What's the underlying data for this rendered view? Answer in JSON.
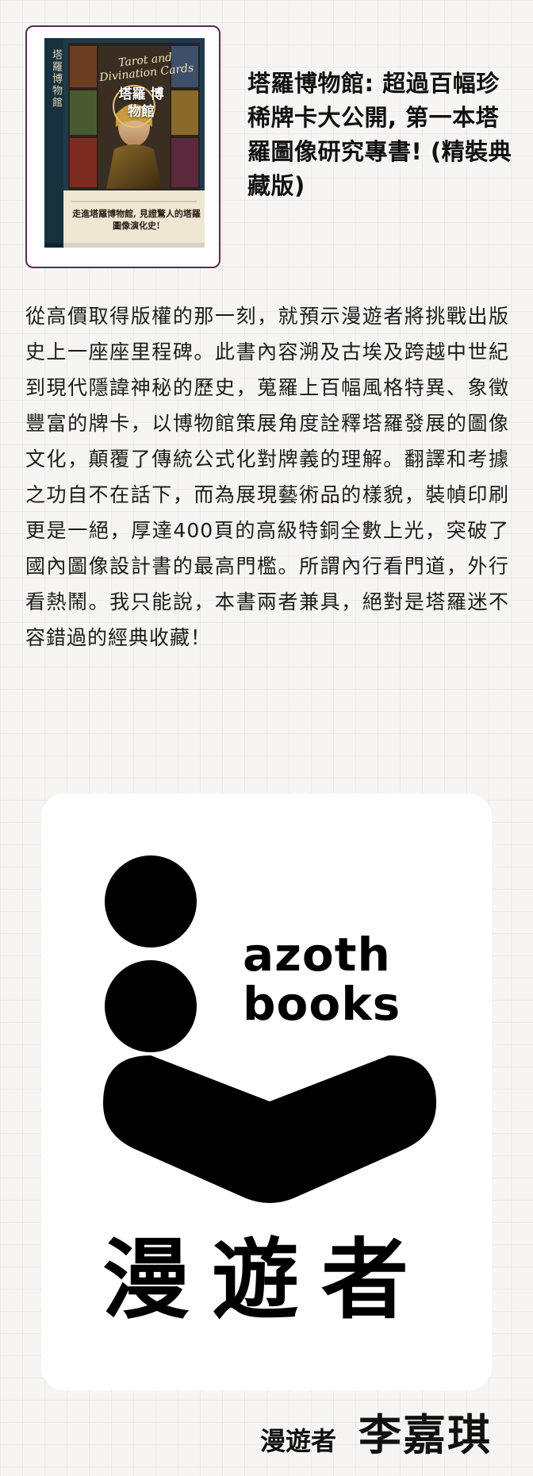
{
  "book": {
    "title": "塔羅博物館: 超過百幅珍稀牌卡大公開, 第一本塔羅圖像研究專書! (精裝典藏版)",
    "cover": {
      "vertical_title": "塔羅博物館",
      "script_title": "Tarot and Divination Cards",
      "main_title": "塔羅 博物館",
      "tagline": "走進塔羅博物館, 見證驚人的塔羅圖像演化史!"
    }
  },
  "review": {
    "text": "從高價取得版權的那一刻，就預示漫遊者將挑戰出版史上一座座里程碑。此書內容溯及古埃及跨越中世紀到現代隱諱神秘的歷史，蒐羅上百幅風格特異、象徵豐富的牌卡，以博物館策展角度詮釋塔羅發展的圖像文化，顛覆了傳統公式化對牌義的理解。翻譯和考據之功自不在話下，而為展現藝術品的樣貌，裝幀印刷更是一絕，厚達400頁的高級特銅全數上光，突破了國內圖像設計書的最高門檻。所謂內行看門道，外行看熱鬧。我只能說，本書兩者兼具，絕對是塔羅迷不容錯過的經典收藏！"
  },
  "publisher_logo": {
    "wordmark_line1": "azoth",
    "wordmark_line2": "books",
    "chinese_name": "漫遊者"
  },
  "signature": {
    "organization": "漫遊者",
    "name": "李嘉琪"
  },
  "colors": {
    "cover_border": "#5a2a4f",
    "cover_background": "#1f3a4a",
    "logo_black": "#000000",
    "page_background": "#f6f5f3"
  }
}
